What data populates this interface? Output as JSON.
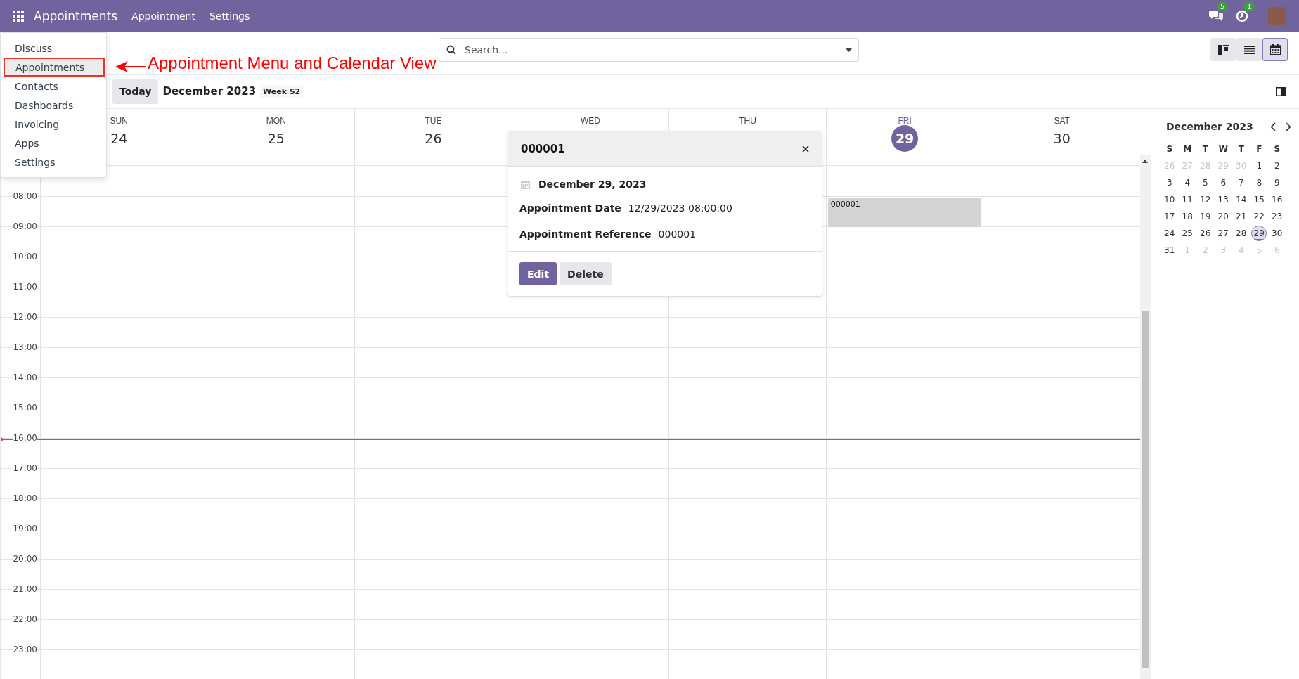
{
  "navbar": {
    "app_name": "Appointments",
    "menu": [
      "Appointment",
      "Settings"
    ],
    "chat_badge": "5",
    "activity_badge": "1"
  },
  "app_menu": {
    "items": [
      {
        "label": "Discuss",
        "selected": false
      },
      {
        "label": "Appointments",
        "selected": true
      },
      {
        "label": "Contacts",
        "selected": false
      },
      {
        "label": "Dashboards",
        "selected": false
      },
      {
        "label": "Invoicing",
        "selected": false
      },
      {
        "label": "Apps",
        "selected": false
      },
      {
        "label": "Settings",
        "selected": false
      }
    ]
  },
  "annotation": {
    "text": "Appointment Menu and Calendar View"
  },
  "search": {
    "placeholder": "Search..."
  },
  "view_switcher": [
    {
      "kind": "kanban",
      "selected": false
    },
    {
      "kind": "list",
      "selected": false
    },
    {
      "kind": "calendar",
      "selected": true
    }
  ],
  "toolbar": {
    "today_label": "Today",
    "period": "December 2023",
    "week": "Week 52"
  },
  "calendar": {
    "days": [
      {
        "weekday": "SUN",
        "date": "24",
        "today": false
      },
      {
        "weekday": "MON",
        "date": "25",
        "today": false
      },
      {
        "weekday": "TUE",
        "date": "26",
        "today": false
      },
      {
        "weekday": "WED",
        "today": false
      },
      {
        "weekday": "THU",
        "today": false
      },
      {
        "weekday": "FRI",
        "date": "29",
        "today": true,
        "events": [
          {
            "title": "000001"
          }
        ]
      },
      {
        "weekday": "SAT",
        "date": "30",
        "today": false
      }
    ],
    "hours": [
      "08:00",
      "09:00",
      "10:00",
      "11:00",
      "12:00",
      "13:00",
      "14:00",
      "15:00",
      "16:00",
      "17:00",
      "18:00",
      "19:00",
      "20:00",
      "21:00",
      "22:00",
      "23:00"
    ]
  },
  "popover": {
    "title": "000001",
    "date": "December 29, 2023",
    "fields": [
      {
        "label": "Appointment Date",
        "value": "12/29/2023 08:00:00"
      },
      {
        "label": "Appointment Reference",
        "value": "000001"
      }
    ],
    "buttons": [
      {
        "label": "Edit",
        "kind": "primary"
      },
      {
        "label": "Delete",
        "kind": "secondary"
      }
    ]
  },
  "mini_calendar": {
    "title": "December 2023",
    "weekdays": [
      "S",
      "M",
      "T",
      "W",
      "T",
      "F",
      "S"
    ],
    "weeks": [
      [
        {
          "d": "26",
          "muted": true,
          "selected": false,
          "today": false
        },
        {
          "d": "27",
          "muted": true,
          "selected": false,
          "today": false
        },
        {
          "d": "28",
          "muted": true,
          "selected": false,
          "today": false
        },
        {
          "d": "29",
          "muted": true,
          "selected": false,
          "today": false
        },
        {
          "d": "30",
          "muted": true,
          "selected": false,
          "today": false
        },
        {
          "d": "1",
          "muted": false,
          "selected": false,
          "today": false
        },
        {
          "d": "2",
          "muted": false,
          "selected": false,
          "today": false
        }
      ],
      [
        {
          "d": "3",
          "muted": false,
          "selected": false,
          "today": false
        },
        {
          "d": "4",
          "muted": false,
          "selected": false,
          "today": false
        },
        {
          "d": "5",
          "muted": false,
          "selected": false,
          "today": false
        },
        {
          "d": "6",
          "muted": false,
          "selected": false,
          "today": false
        },
        {
          "d": "7",
          "muted": false,
          "selected": false,
          "today": false
        },
        {
          "d": "8",
          "muted": false,
          "selected": false,
          "today": false
        },
        {
          "d": "9",
          "muted": false,
          "selected": false,
          "today": false
        }
      ],
      [
        {
          "d": "10",
          "muted": false,
          "selected": false,
          "today": false
        },
        {
          "d": "11",
          "muted": false,
          "selected": false,
          "today": false
        },
        {
          "d": "12",
          "muted": false,
          "selected": false,
          "today": false
        },
        {
          "d": "13",
          "muted": false,
          "selected": false,
          "today": false
        },
        {
          "d": "14",
          "muted": false,
          "selected": false,
          "today": false
        },
        {
          "d": "15",
          "muted": false,
          "selected": false,
          "today": false
        },
        {
          "d": "16",
          "muted": false,
          "selected": false,
          "today": false
        }
      ],
      [
        {
          "d": "17",
          "muted": false,
          "selected": false,
          "today": false
        },
        {
          "d": "18",
          "muted": false,
          "selected": false,
          "today": false
        },
        {
          "d": "19",
          "muted": false,
          "selected": false,
          "today": false
        },
        {
          "d": "20",
          "muted": false,
          "selected": false,
          "today": false
        },
        {
          "d": "21",
          "muted": false,
          "selected": false,
          "today": false
        },
        {
          "d": "22",
          "muted": false,
          "selected": false,
          "today": false
        },
        {
          "d": "23",
          "muted": false,
          "selected": false,
          "today": false
        }
      ],
      [
        {
          "d": "24",
          "muted": false,
          "selected": false,
          "today": false
        },
        {
          "d": "25",
          "muted": false,
          "selected": false,
          "today": false
        },
        {
          "d": "26",
          "muted": false,
          "selected": false,
          "today": false
        },
        {
          "d": "27",
          "muted": false,
          "selected": false,
          "today": false
        },
        {
          "d": "28",
          "muted": false,
          "selected": false,
          "today": false
        },
        {
          "d": "29",
          "muted": false,
          "selected": true,
          "today": true
        },
        {
          "d": "30",
          "muted": false,
          "selected": false,
          "today": false
        }
      ],
      [
        {
          "d": "31",
          "muted": false,
          "selected": false,
          "today": false
        },
        {
          "d": "1",
          "muted": true,
          "selected": false,
          "today": false
        },
        {
          "d": "2",
          "muted": true,
          "selected": false,
          "today": false
        },
        {
          "d": "3",
          "muted": true,
          "selected": false,
          "today": false
        },
        {
          "d": "4",
          "muted": true,
          "selected": false,
          "today": false
        },
        {
          "d": "5",
          "muted": true,
          "selected": false,
          "today": false
        },
        {
          "d": "6",
          "muted": true,
          "selected": false,
          "today": false
        }
      ]
    ]
  }
}
